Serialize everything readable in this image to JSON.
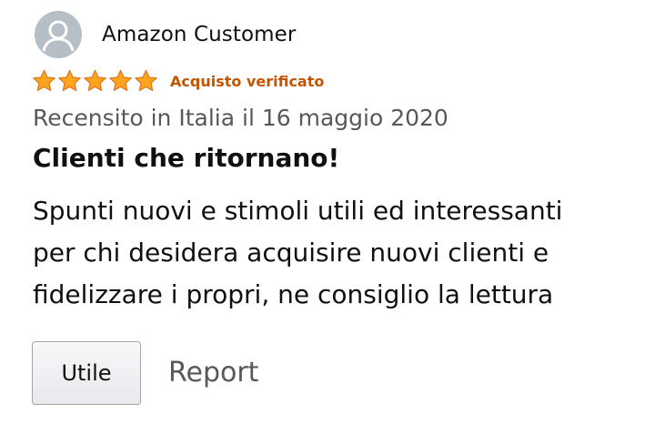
{
  "profile": {
    "name": "Amazon Customer",
    "avatar_icon": "default-user-icon"
  },
  "rating": {
    "stars": 5,
    "max_stars": 5,
    "star_color": "#ffa41c",
    "verified_label": "Acquisto verificato"
  },
  "review": {
    "date": "Recensito in Italia il 16 maggio 2020",
    "title": "Clienti che ritornano!",
    "body_lines": [
      "Spunti nuovi e stimoli utili ed interessanti",
      "per chi desidera acquisire nuovi clienti e",
      "fidelizzare i propri, ne consiglio la lettura"
    ]
  },
  "actions": {
    "helpful_label": "Utile",
    "report_label": "Report"
  },
  "colors": {
    "verified": "#c45500",
    "secondary_text": "#565959",
    "primary_text": "#0f1111"
  }
}
